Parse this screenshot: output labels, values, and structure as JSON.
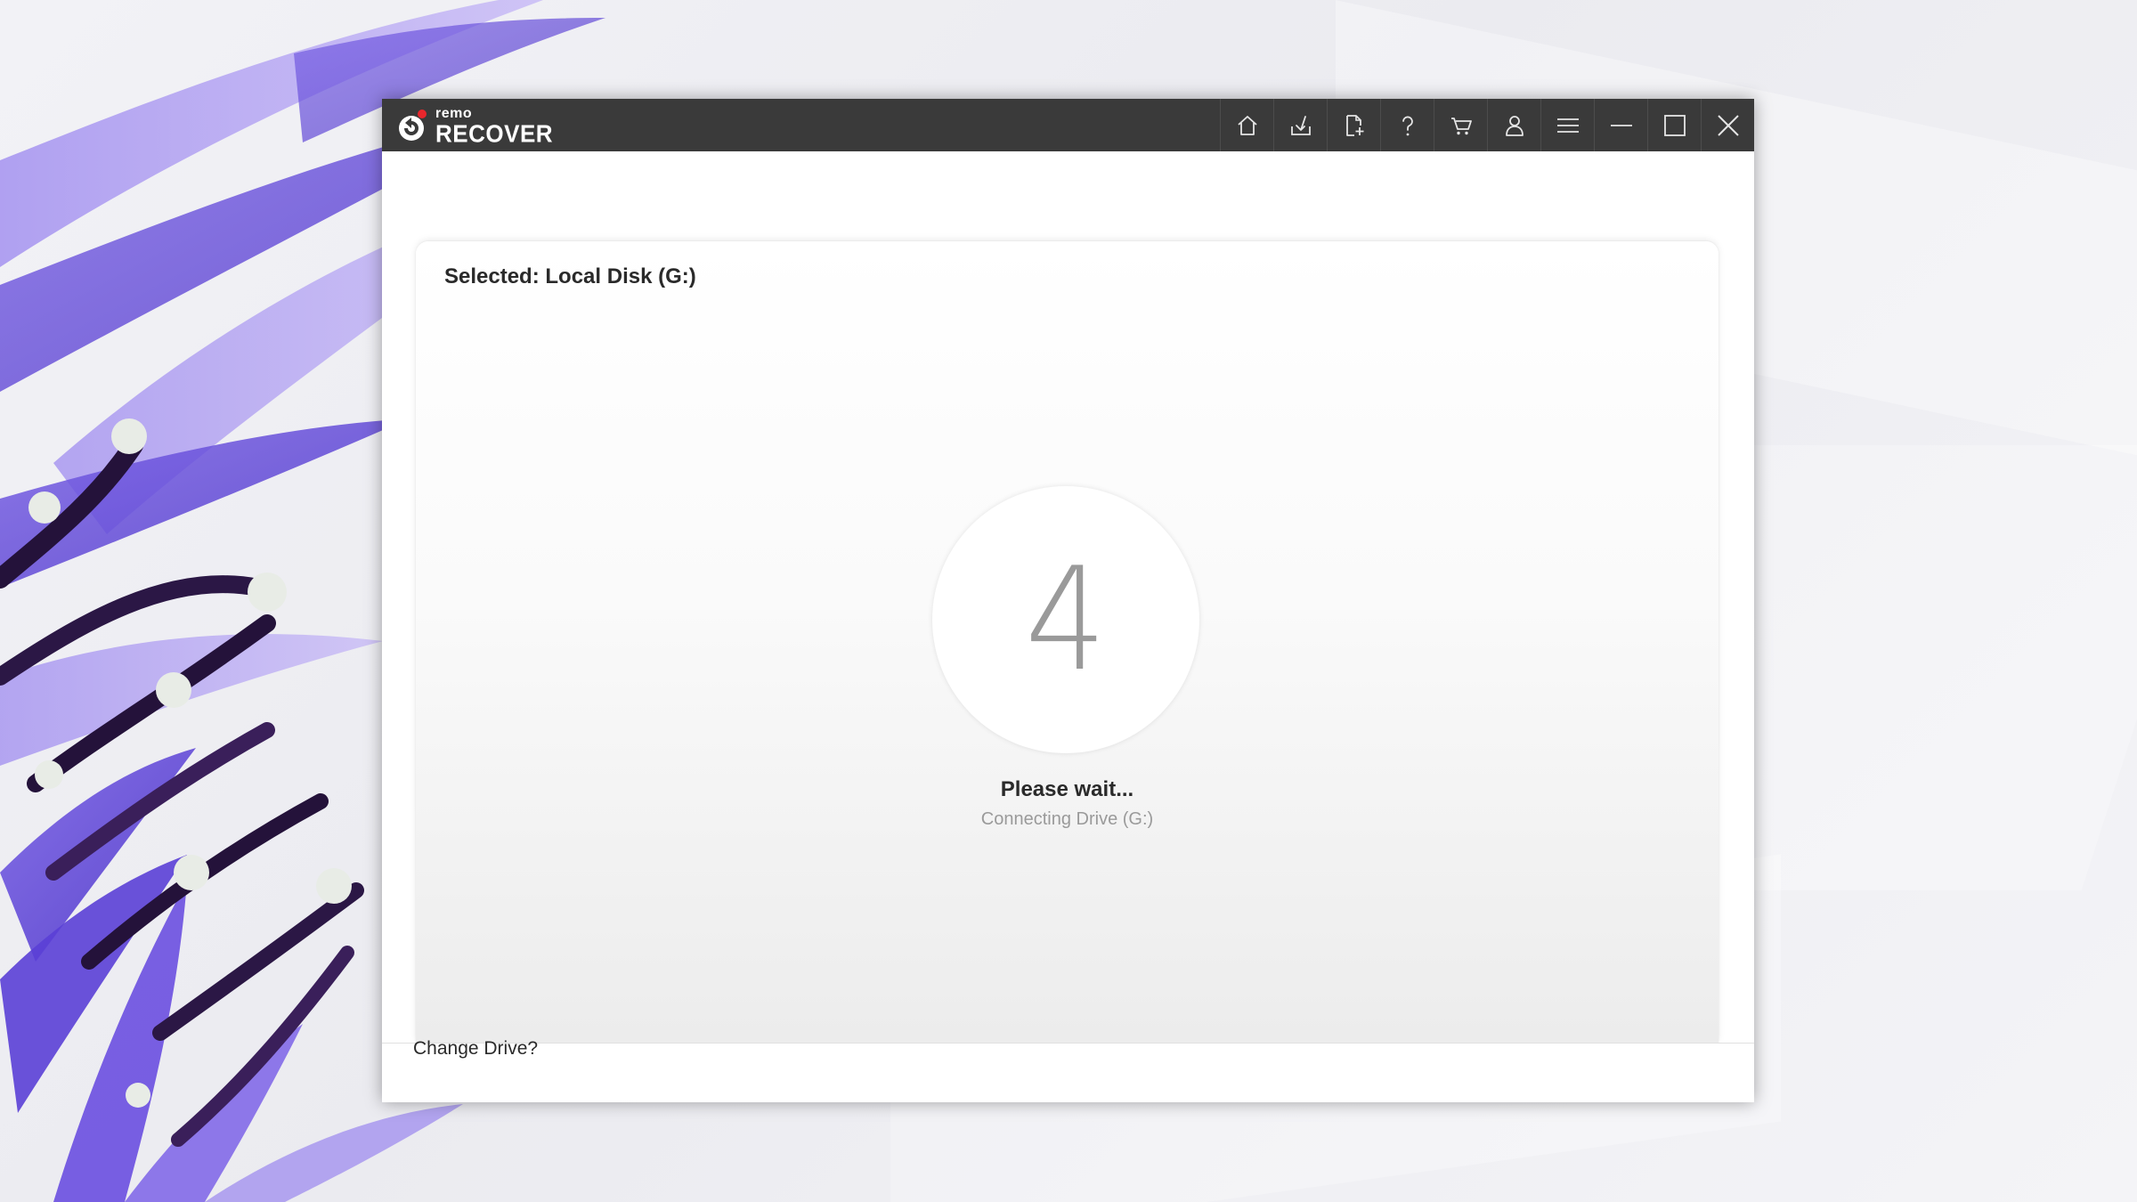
{
  "app": {
    "logo_small": "remo",
    "logo_big": "RECOVER",
    "accent_color": "#e8262c",
    "titlebar_color": "#3a3a3a"
  },
  "toolbar": {
    "buttons": [
      {
        "icon": "home-icon"
      },
      {
        "icon": "download-icon"
      },
      {
        "icon": "add-file-icon"
      },
      {
        "icon": "help-icon"
      },
      {
        "icon": "cart-icon"
      },
      {
        "icon": "user-icon"
      },
      {
        "icon": "menu-icon"
      },
      {
        "icon": "minimize-icon"
      },
      {
        "icon": "maximize-icon"
      },
      {
        "icon": "close-icon"
      }
    ]
  },
  "main": {
    "selected_label": "Selected: Local Disk (G:)",
    "counter": "4",
    "wait_title": "Please wait...",
    "wait_subtitle": "Connecting Drive (G:)"
  },
  "footer": {
    "change_drive": "Change Drive?"
  }
}
